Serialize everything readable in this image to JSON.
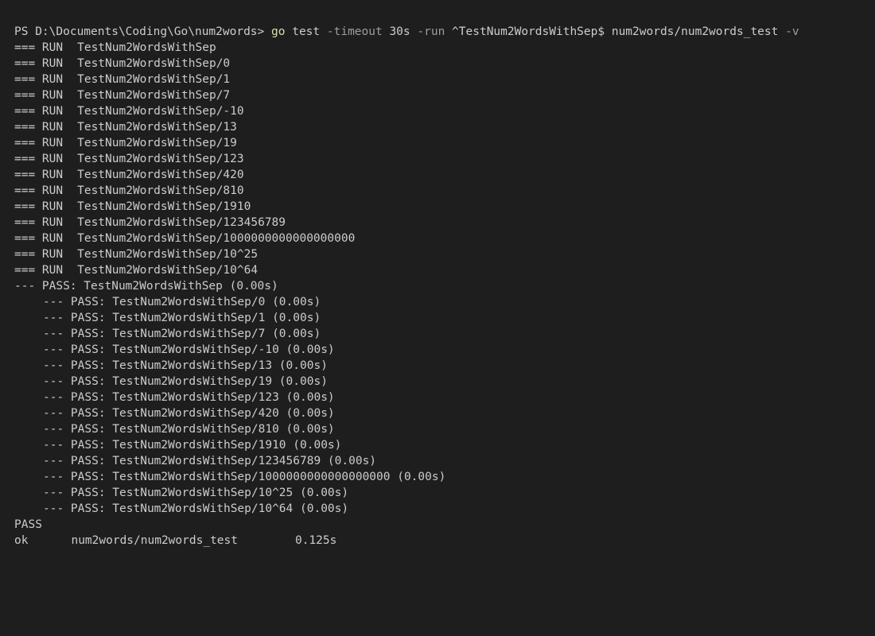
{
  "terminal": {
    "prompt": {
      "path": "PS D:\\Documents\\Coding\\Go\\num2words>",
      "cmd": "go",
      "subcmd": "test",
      "flag1": "-timeout",
      "flag1_value": "30s",
      "flag2": "-run",
      "flag2_value": "^TestNum2WordsWithSep$",
      "package": "num2words/num2words_test",
      "flag3": "-v"
    },
    "run_lines": [
      {
        "prefix": "=== RUN",
        "name": "TestNum2WordsWithSep"
      },
      {
        "prefix": "=== RUN",
        "name": "TestNum2WordsWithSep/0"
      },
      {
        "prefix": "=== RUN",
        "name": "TestNum2WordsWithSep/1"
      },
      {
        "prefix": "=== RUN",
        "name": "TestNum2WordsWithSep/7"
      },
      {
        "prefix": "=== RUN",
        "name": "TestNum2WordsWithSep/-10"
      },
      {
        "prefix": "=== RUN",
        "name": "TestNum2WordsWithSep/13"
      },
      {
        "prefix": "=== RUN",
        "name": "TestNum2WordsWithSep/19"
      },
      {
        "prefix": "=== RUN",
        "name": "TestNum2WordsWithSep/123"
      },
      {
        "prefix": "=== RUN",
        "name": "TestNum2WordsWithSep/420"
      },
      {
        "prefix": "=== RUN",
        "name": "TestNum2WordsWithSep/810"
      },
      {
        "prefix": "=== RUN",
        "name": "TestNum2WordsWithSep/1910"
      },
      {
        "prefix": "=== RUN",
        "name": "TestNum2WordsWithSep/123456789"
      },
      {
        "prefix": "=== RUN",
        "name": "TestNum2WordsWithSep/1000000000000000000"
      },
      {
        "prefix": "=== RUN",
        "name": "TestNum2WordsWithSep/10^25"
      },
      {
        "prefix": "=== RUN",
        "name": "TestNum2WordsWithSep/10^64"
      }
    ],
    "pass_parent": "--- PASS: TestNum2WordsWithSep (0.00s)",
    "pass_lines": [
      "--- PASS: TestNum2WordsWithSep/0 (0.00s)",
      "--- PASS: TestNum2WordsWithSep/1 (0.00s)",
      "--- PASS: TestNum2WordsWithSep/7 (0.00s)",
      "--- PASS: TestNum2WordsWithSep/-10 (0.00s)",
      "--- PASS: TestNum2WordsWithSep/13 (0.00s)",
      "--- PASS: TestNum2WordsWithSep/19 (0.00s)",
      "--- PASS: TestNum2WordsWithSep/123 (0.00s)",
      "--- PASS: TestNum2WordsWithSep/420 (0.00s)",
      "--- PASS: TestNum2WordsWithSep/810 (0.00s)",
      "--- PASS: TestNum2WordsWithSep/1910 (0.00s)",
      "--- PASS: TestNum2WordsWithSep/123456789 (0.00s)",
      "--- PASS: TestNum2WordsWithSep/1000000000000000000 (0.00s)",
      "--- PASS: TestNum2WordsWithSep/10^25 (0.00s)",
      "--- PASS: TestNum2WordsWithSep/10^64 (0.00s)"
    ],
    "summary": "PASS",
    "result": {
      "status": "ok",
      "package": "num2words/num2words_test",
      "time": "0.125s"
    },
    "colors": {
      "background": "#1e1e1e",
      "text": "#cccccc",
      "command": "#dcdcaa",
      "flag": "#9d9d9d"
    }
  }
}
